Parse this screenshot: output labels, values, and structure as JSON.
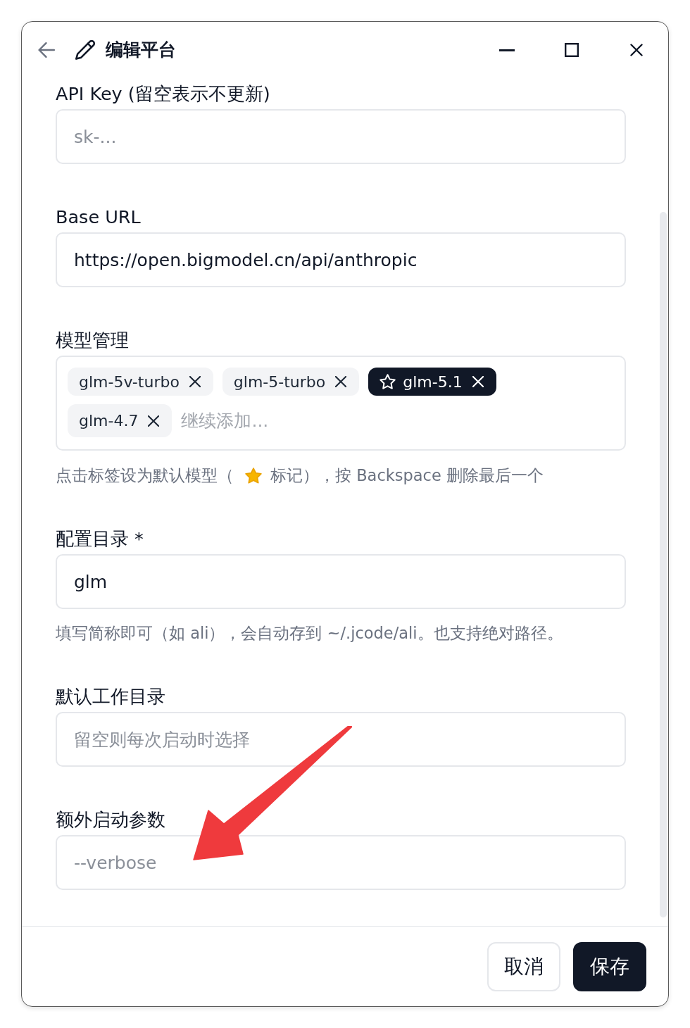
{
  "window": {
    "title": "编辑平台"
  },
  "fields": [
    {
      "kind": "input",
      "label": "API Key (留空表示不更新)",
      "placeholder": "sk-..."
    },
    {
      "kind": "input",
      "label": "Base URL",
      "value": "https://open.bigmodel.cn/api/anthropic"
    },
    {
      "kind": "tags",
      "label": "模型管理",
      "tags": [
        {
          "text": "glm-5v-turbo",
          "selected": false
        },
        {
          "text": "glm-5-turbo",
          "selected": false
        },
        {
          "text": "glm-5.1",
          "selected": true
        },
        {
          "text": "glm-4.7",
          "selected": false
        }
      ],
      "placeholder": "继续添加...",
      "hint": [
        {
          "kind": "text",
          "text": "点击标签设为默认模型（"
        },
        {
          "kind": "star_icon"
        },
        {
          "kind": "text",
          "text": "标记），按 Backspace 删除最后一个"
        }
      ]
    },
    {
      "kind": "input",
      "label": "配置目录 *",
      "value": "glm",
      "hint": [
        {
          "kind": "text",
          "text": "填写简称即可（如 ali），会自动存到 ~/.jcode/ali。也支持绝对路径。"
        }
      ]
    },
    {
      "kind": "input",
      "label": "默认工作目录",
      "placeholder": "留空则每次启动时选择"
    },
    {
      "kind": "input",
      "label": "额外启动参数",
      "placeholder": "--verbose"
    }
  ],
  "buttons": [
    {
      "kind": "secondary",
      "label": "取消"
    },
    {
      "kind": "primary",
      "label": "保存"
    }
  ]
}
